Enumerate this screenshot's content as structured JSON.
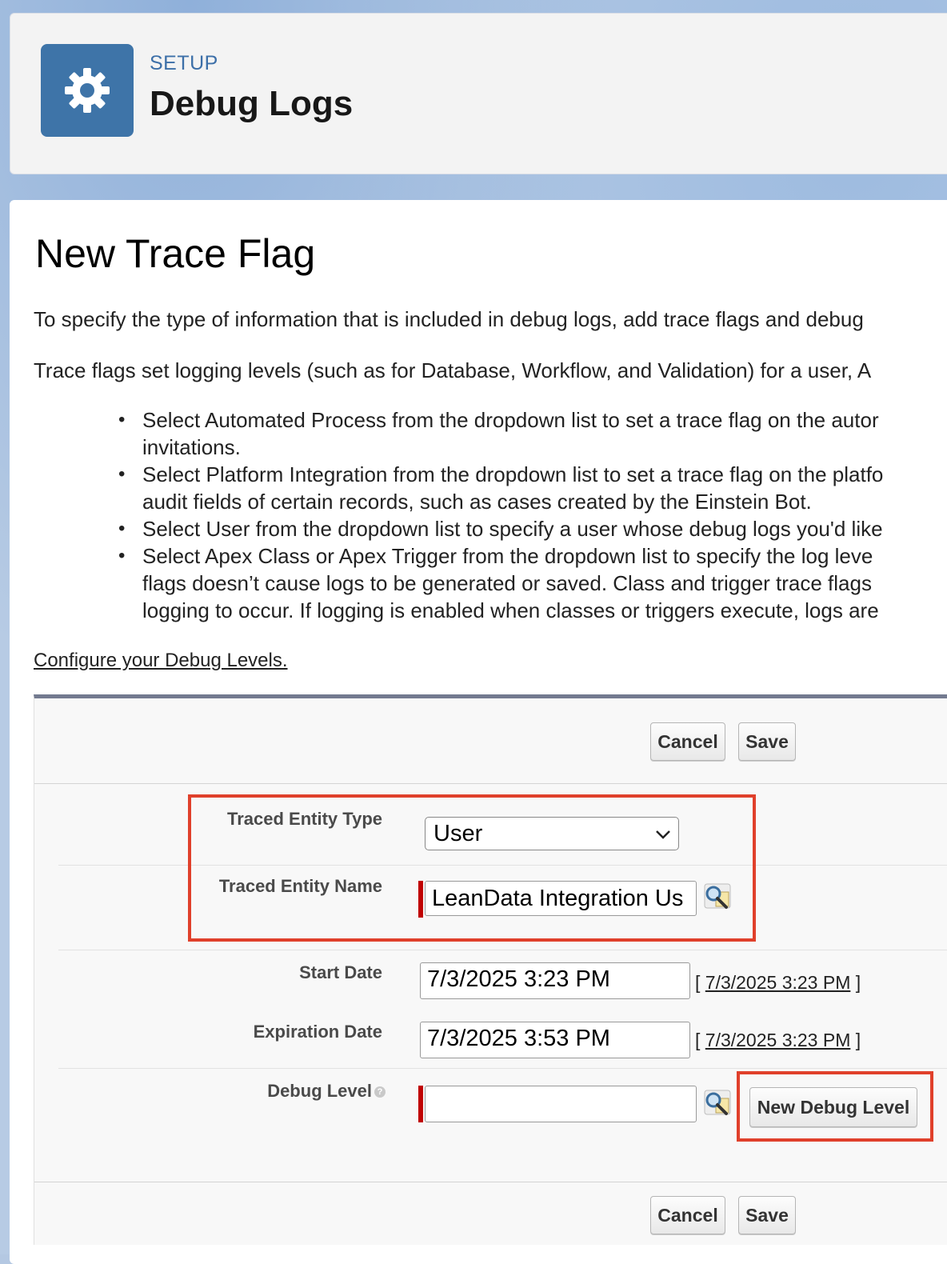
{
  "header": {
    "eyebrow": "SETUP",
    "title": "Debug Logs",
    "icon": "gear-icon",
    "icon_color": "#3e74a8"
  },
  "page": {
    "heading": "New Trace Flag",
    "intro_1": "To specify the type of information that is included in debug logs, add trace flags and debug",
    "intro_2": "Trace flags set logging levels (such as for Database, Workflow, and Validation) for a user, A",
    "bullets": [
      "Select Automated Process from the dropdown list to set a trace flag on the autor",
      "invitations.",
      "Select Platform Integration from the dropdown list to set a trace flag on the platfo",
      "audit fields of certain records, such as cases created by the Einstein Bot.",
      "Select User from the dropdown list to specify a user whose debug logs you'd like",
      "Select Apex Class or Apex Trigger from the dropdown list to specify the log leve",
      "flags doesn’t cause logs to be generated or saved. Class and trigger trace flags",
      "logging to occur. If logging is enabled when classes or triggers execute, logs are"
    ],
    "config_link": "Configure your Debug Levels."
  },
  "buttons": {
    "cancel": "Cancel",
    "save": "Save",
    "new_debug_level": "New Debug Level"
  },
  "form": {
    "entity_type_label": "Traced Entity Type",
    "entity_type_value": "User",
    "entity_name_label": "Traced Entity Name",
    "entity_name_value": "LeanData Integration Us",
    "start_date_label": "Start Date",
    "start_date_value": "7/3/2025 3:23 PM",
    "start_date_link": "7/3/2025 3:23 PM",
    "expiration_date_label": "Expiration Date",
    "expiration_date_value": "7/3/2025 3:53 PM",
    "expiration_date_link": "7/3/2025 3:23 PM",
    "debug_level_label": "Debug Level",
    "debug_level_value": ""
  },
  "colors": {
    "highlight": "#e0402b",
    "required": "#c00000"
  }
}
